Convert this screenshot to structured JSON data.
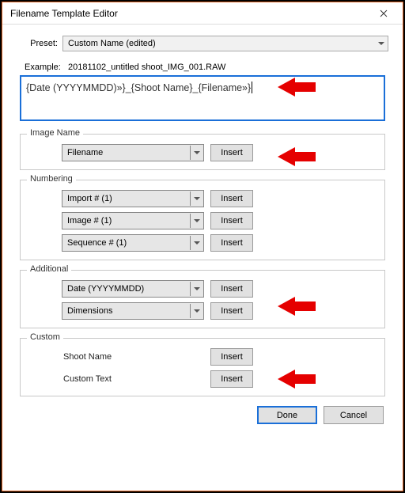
{
  "window": {
    "title": "Filename Template Editor",
    "close": "×"
  },
  "preset": {
    "label": "Preset:",
    "value": "Custom Name (edited)"
  },
  "example": {
    "label": "Example:",
    "value": "20181102_untitled shoot_IMG_001.RAW"
  },
  "template": "{Date (YYYYMMDD)»}_{Shoot Name}_{Filename»}",
  "groups": {
    "image_name": {
      "legend": "Image Name",
      "rows": [
        {
          "select": "Filename",
          "button": "Insert"
        }
      ]
    },
    "numbering": {
      "legend": "Numbering",
      "rows": [
        {
          "select": "Import # (1)",
          "button": "Insert"
        },
        {
          "select": "Image # (1)",
          "button": "Insert"
        },
        {
          "select": "Sequence # (1)",
          "button": "Insert"
        }
      ]
    },
    "additional": {
      "legend": "Additional",
      "rows": [
        {
          "select": "Date (YYYYMMDD)",
          "button": "Insert"
        },
        {
          "select": "Dimensions",
          "button": "Insert"
        }
      ]
    },
    "custom": {
      "legend": "Custom",
      "rows": [
        {
          "label": "Shoot Name",
          "button": "Insert"
        },
        {
          "label": "Custom Text",
          "button": "Insert"
        }
      ]
    }
  },
  "buttons": {
    "done": "Done",
    "cancel": "Cancel"
  }
}
